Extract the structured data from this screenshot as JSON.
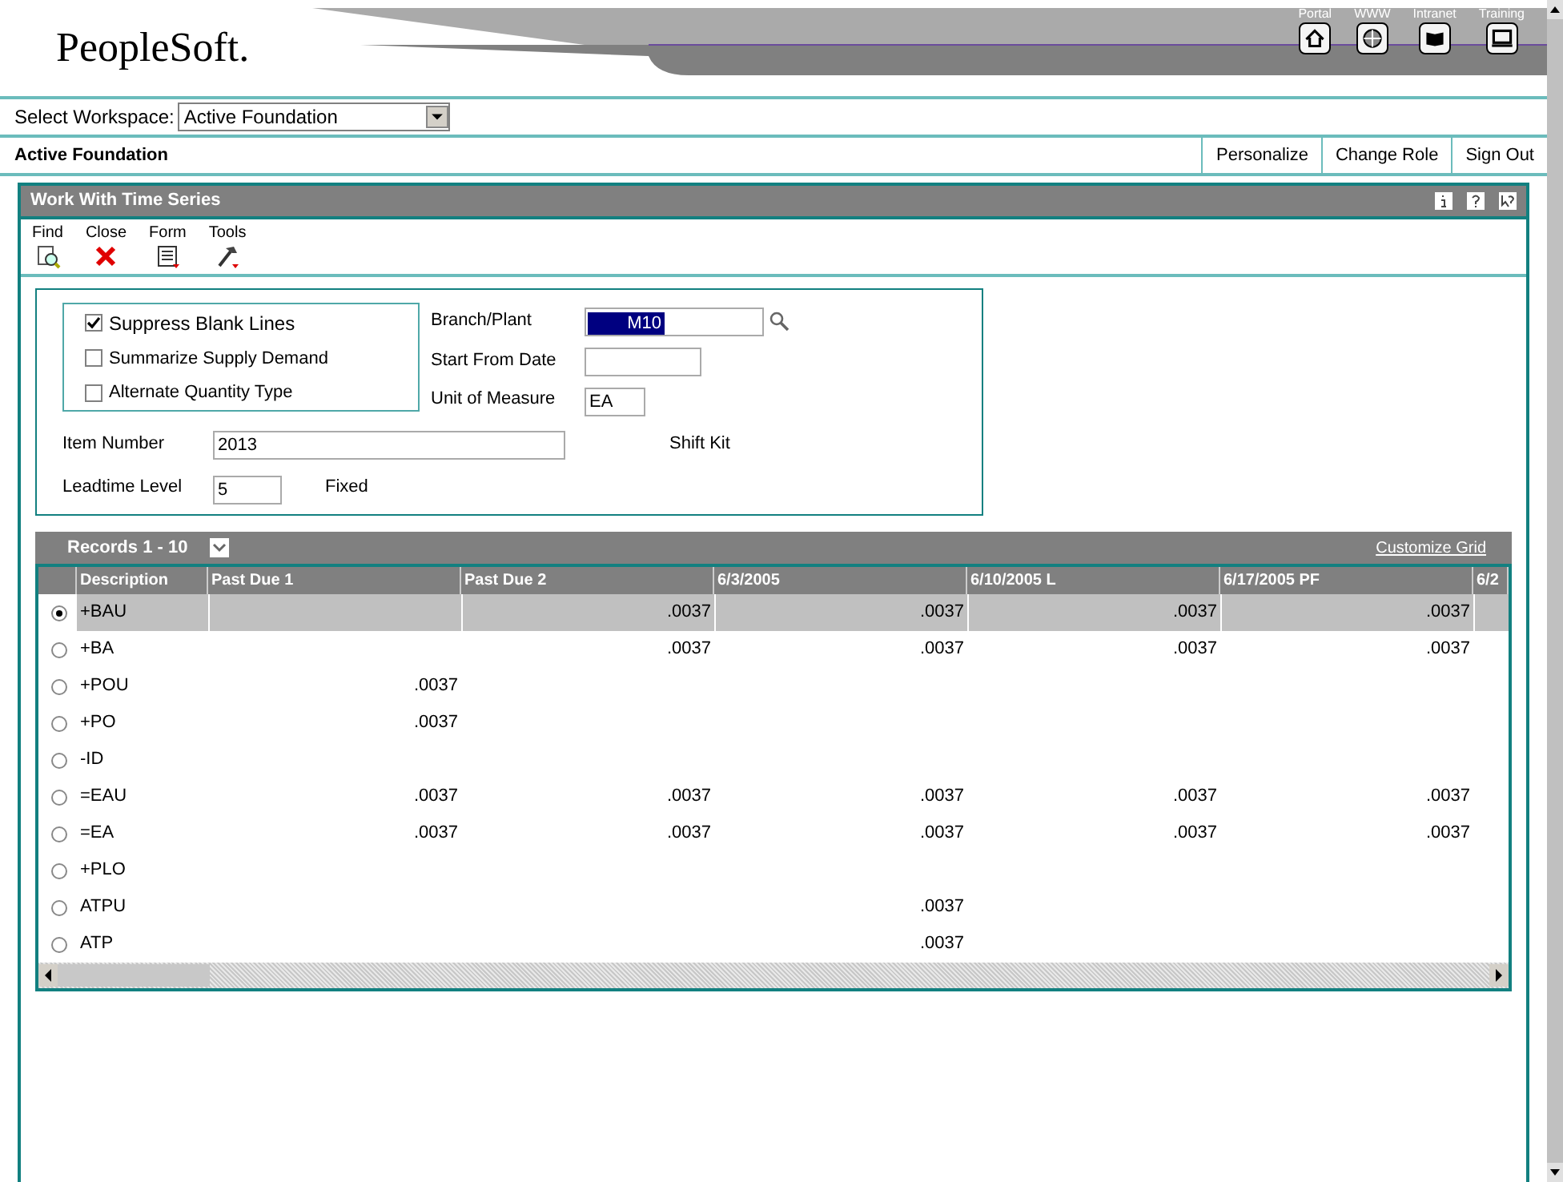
{
  "header": {
    "logo": "PeopleSoft.",
    "links": [
      {
        "label": "Portal",
        "kind": "home"
      },
      {
        "label": "WWW",
        "kind": "globe"
      },
      {
        "label": "Intranet",
        "kind": "book"
      },
      {
        "label": "Training",
        "kind": "monitor"
      }
    ]
  },
  "workspace": {
    "label": "Select Workspace:",
    "value": "Active Foundation"
  },
  "role_bar": {
    "title": "Active Foundation",
    "links": [
      "Personalize",
      "Change Role",
      "Sign Out"
    ]
  },
  "form": {
    "title": "Work With Time Series",
    "toolbar": [
      {
        "label": "Find",
        "kind": "find"
      },
      {
        "label": "Close",
        "kind": "close"
      },
      {
        "label": "Form",
        "kind": "form"
      },
      {
        "label": "Tools",
        "kind": "tools"
      }
    ],
    "options": [
      {
        "label": "Suppress Blank Lines",
        "checked": true
      },
      {
        "label": "Summarize Supply Demand",
        "checked": false
      },
      {
        "label": "Alternate Quantity Type",
        "checked": false
      }
    ],
    "branch_plant": {
      "label": "Branch/Plant",
      "value": "M10"
    },
    "start_from_date": {
      "label": "Start From Date"
    },
    "unit_of_measure": {
      "label": "Unit of Measure",
      "value": "EA"
    },
    "item_number": {
      "label": "Item Number",
      "value": "2013",
      "description": "Shift Kit"
    },
    "leadtime_level": {
      "label": "Leadtime Level",
      "value": "5",
      "description": "Fixed"
    }
  },
  "grid": {
    "title": "Records 1 - 10",
    "customize": "Customize Grid",
    "columns": [
      "Description",
      "Past Due 1",
      "Past Due 2",
      "6/3/2005",
      "6/10/2005 L",
      "6/17/2005 PF",
      "6/2"
    ],
    "rows": [
      {
        "selected": true,
        "description": "+BAU",
        "cells": [
          null,
          ".0037",
          ".0037",
          ".0037",
          ".0037"
        ]
      },
      {
        "selected": false,
        "description": "+BA",
        "cells": [
          null,
          ".0037",
          ".0037",
          ".0037",
          ".0037"
        ]
      },
      {
        "selected": false,
        "description": "+POU",
        "cells": [
          ".0037",
          null,
          null,
          null,
          null
        ]
      },
      {
        "selected": false,
        "description": "+PO",
        "cells": [
          ".0037",
          null,
          null,
          null,
          null
        ]
      },
      {
        "selected": false,
        "description": "-ID",
        "cells": [
          null,
          null,
          null,
          null,
          null
        ]
      },
      {
        "selected": false,
        "description": "=EAU",
        "cells": [
          ".0037",
          ".0037",
          ".0037",
          ".0037",
          ".0037"
        ]
      },
      {
        "selected": false,
        "description": "=EA",
        "cells": [
          ".0037",
          ".0037",
          ".0037",
          ".0037",
          ".0037"
        ]
      },
      {
        "selected": false,
        "description": "+PLO",
        "cells": [
          null,
          null,
          null,
          null,
          null
        ]
      },
      {
        "selected": false,
        "description": "ATPU",
        "cells": [
          null,
          null,
          ".0037",
          null,
          null
        ]
      },
      {
        "selected": false,
        "description": "ATP",
        "cells": [
          null,
          null,
          ".0037",
          null,
          null
        ]
      }
    ]
  }
}
